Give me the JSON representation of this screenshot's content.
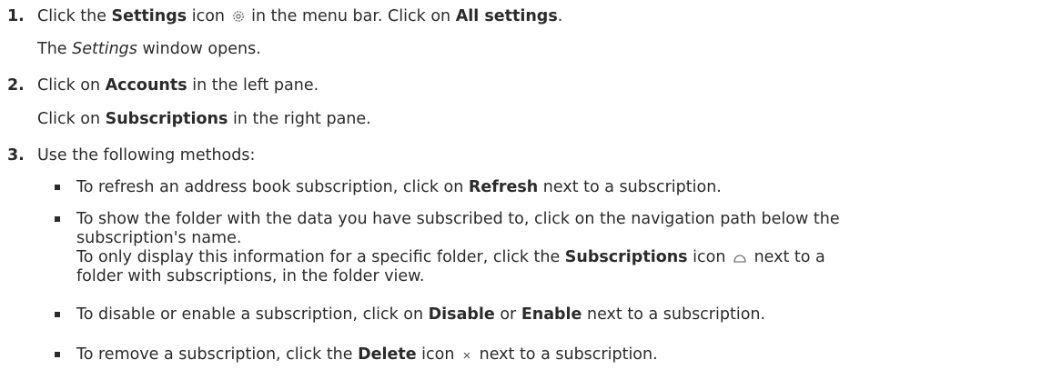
{
  "steps": [
    {
      "number": "1.",
      "line1": {
        "pre": "Click the ",
        "bold1": "Settings",
        "mid": " icon",
        "post": " in the menu bar. Click on ",
        "bold2": "All settings",
        "end": "."
      },
      "line2": {
        "pre": "The ",
        "italic": "Settings",
        "post": " window opens."
      },
      "icon": "gear-icon"
    },
    {
      "number": "2.",
      "line1": {
        "pre": "Click on ",
        "bold": "Accounts",
        "post": " in the left pane."
      },
      "line2": {
        "pre": "Click on ",
        "bold": "Subscriptions",
        "post": " in the right pane."
      }
    },
    {
      "number": "3.",
      "line1": {
        "text": "Use the following methods:"
      },
      "bullets": [
        {
          "pre": "To refresh an address book subscription, click on ",
          "bold": "Refresh",
          "post": " next to a subscription."
        },
        {
          "l1": "To show the folder with the data you have subscribed to, click on the navigation path below the",
          "l2": "subscription's name.",
          "l3pre": "To only display this information for a specific folder, click the ",
          "l3bold": "Subscriptions",
          "l3mid": " icon",
          "l3post": " next to a",
          "l4": "folder with subscriptions, in the folder view.",
          "icon": "cloud-icon"
        },
        {
          "pre": "To disable or enable a subscription, click on ",
          "bold1": "Disable",
          "mid": " or ",
          "bold2": "Enable",
          "post": " next to a subscription."
        },
        {
          "pre": "To remove a subscription, click the ",
          "bold": "Delete",
          "mid": " icon",
          "post": " next to a subscription.",
          "icon": "close-icon"
        }
      ]
    }
  ]
}
